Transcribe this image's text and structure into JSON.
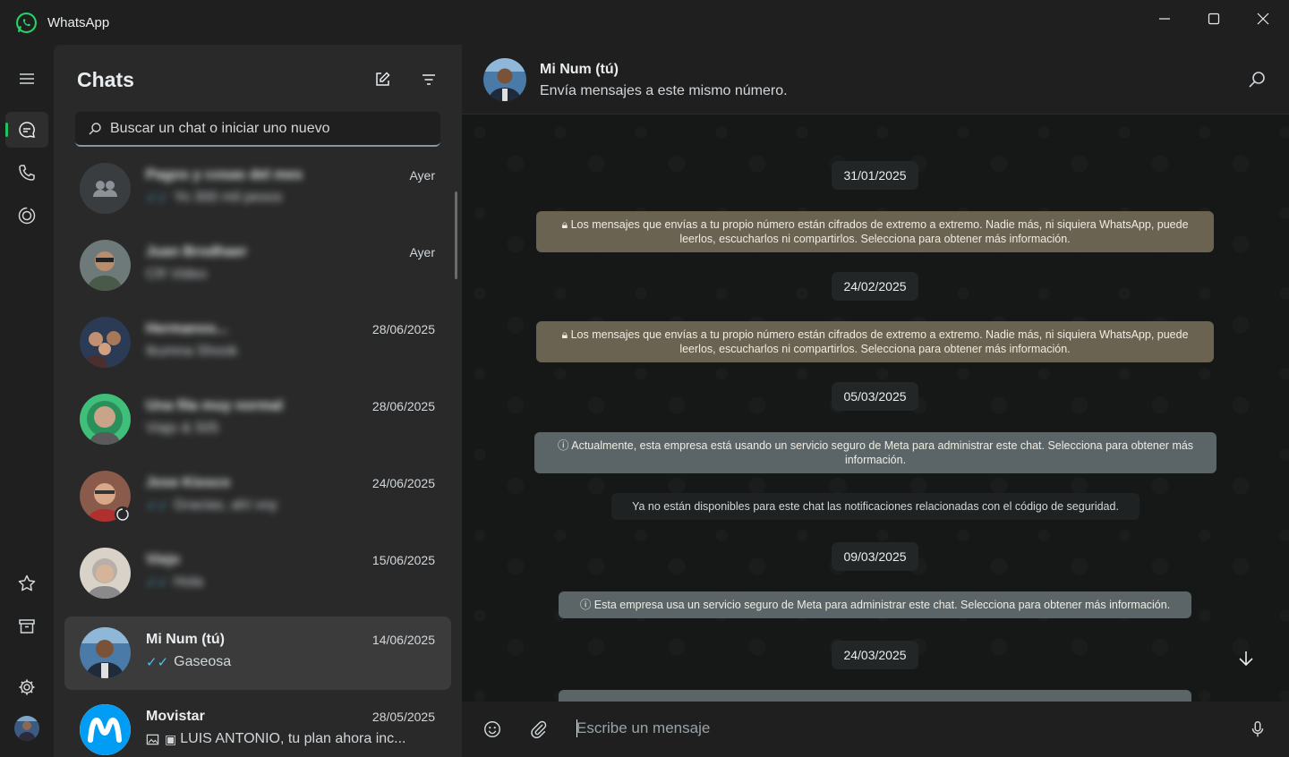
{
  "app": {
    "title": "WhatsApp",
    "brand_color": "#25d366",
    "accent": "#21c063"
  },
  "window_controls": [
    "minimize-icon",
    "maximize-icon",
    "close-icon"
  ],
  "rail": {
    "top": [
      "menu-icon",
      "chats-icon",
      "calls-icon",
      "status-icon"
    ],
    "bottom": [
      "starred-icon",
      "archive-icon",
      "settings-icon"
    ]
  },
  "chatlist": {
    "title": "Chats",
    "search_placeholder": "Buscar un chat o iniciar uno nuevo",
    "items": [
      {
        "name": "Pagos y cosas del mes",
        "preview": "Yo 300 mil pesos",
        "time": "Ayer",
        "blurred": true,
        "ticks": true
      },
      {
        "name": "Juan Brodhaer",
        "preview": "CR Video",
        "time": "Ayer",
        "blurred": true,
        "ticks": false
      },
      {
        "name": "Hermanos...",
        "preview": "Ikumna Shook",
        "time": "28/06/2025",
        "blurred": true,
        "ticks": false
      },
      {
        "name": "Una fila muy normal",
        "preview": "Viajo & 505",
        "time": "28/06/2025",
        "blurred": true,
        "ticks": false
      },
      {
        "name": "Jose Kiosco",
        "preview": "Gracias, ahí voy",
        "time": "24/06/2025",
        "blurred": true,
        "ticks": true
      },
      {
        "name": "Viejo",
        "preview": "Hola",
        "time": "15/06/2025",
        "blurred": true,
        "ticks": true
      },
      {
        "name": "Mi Num (tú)",
        "preview": "Gaseosa",
        "time": "14/06/2025",
        "blurred": false,
        "ticks": true
      },
      {
        "name": "Movistar",
        "preview": "LUIS ANTONIO, tu plan ahora inc...",
        "time": "28/05/2025",
        "blurred": false,
        "ticks": false
      }
    ]
  },
  "conversation": {
    "name": "Mi Num (tú)",
    "subtitle": "Envía mensajes a este mismo número.",
    "dates": [
      "31/01/2025",
      "24/02/2025",
      "05/03/2025",
      "09/03/2025",
      "24/03/2025"
    ],
    "encryption_notice": "Los mensajes que envías a tu propio número están cifrados de extremo a extremo. Nadie más, ni siquiera WhatsApp, puede leerlos, escucharlos ni compartirlos. Selecciona para obtener más información.",
    "meta_notice_1": "Actualmente, esta empresa está usando un servicio seguro de Meta para administrar este chat. Selecciona para obtener más información.",
    "security_notice": "Ya no están disponibles para este chat las notificaciones relacionadas con el código de seguridad.",
    "meta_notice_2": "Esta empresa usa un servicio seguro de Meta para administrar este chat. Selecciona para obtener más información.",
    "composer_placeholder": "Escribe un mensaje"
  }
}
